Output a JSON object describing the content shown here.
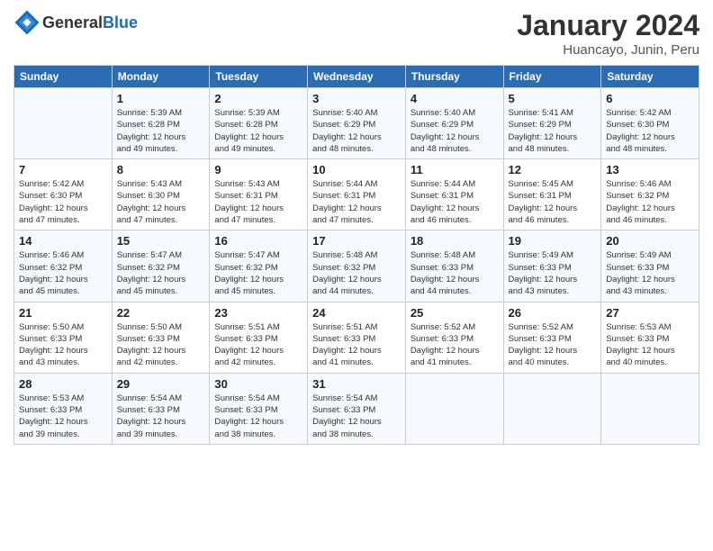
{
  "header": {
    "logo_general": "General",
    "logo_blue": "Blue",
    "month_year": "January 2024",
    "location": "Huancayo, Junin, Peru"
  },
  "days_of_week": [
    "Sunday",
    "Monday",
    "Tuesday",
    "Wednesday",
    "Thursday",
    "Friday",
    "Saturday"
  ],
  "weeks": [
    [
      {
        "day": "",
        "info": ""
      },
      {
        "day": "1",
        "info": "Sunrise: 5:39 AM\nSunset: 6:28 PM\nDaylight: 12 hours\nand 49 minutes."
      },
      {
        "day": "2",
        "info": "Sunrise: 5:39 AM\nSunset: 6:28 PM\nDaylight: 12 hours\nand 49 minutes."
      },
      {
        "day": "3",
        "info": "Sunrise: 5:40 AM\nSunset: 6:29 PM\nDaylight: 12 hours\nand 48 minutes."
      },
      {
        "day": "4",
        "info": "Sunrise: 5:40 AM\nSunset: 6:29 PM\nDaylight: 12 hours\nand 48 minutes."
      },
      {
        "day": "5",
        "info": "Sunrise: 5:41 AM\nSunset: 6:29 PM\nDaylight: 12 hours\nand 48 minutes."
      },
      {
        "day": "6",
        "info": "Sunrise: 5:42 AM\nSunset: 6:30 PM\nDaylight: 12 hours\nand 48 minutes."
      }
    ],
    [
      {
        "day": "7",
        "info": "Sunrise: 5:42 AM\nSunset: 6:30 PM\nDaylight: 12 hours\nand 47 minutes."
      },
      {
        "day": "8",
        "info": "Sunrise: 5:43 AM\nSunset: 6:30 PM\nDaylight: 12 hours\nand 47 minutes."
      },
      {
        "day": "9",
        "info": "Sunrise: 5:43 AM\nSunset: 6:31 PM\nDaylight: 12 hours\nand 47 minutes."
      },
      {
        "day": "10",
        "info": "Sunrise: 5:44 AM\nSunset: 6:31 PM\nDaylight: 12 hours\nand 47 minutes."
      },
      {
        "day": "11",
        "info": "Sunrise: 5:44 AM\nSunset: 6:31 PM\nDaylight: 12 hours\nand 46 minutes."
      },
      {
        "day": "12",
        "info": "Sunrise: 5:45 AM\nSunset: 6:31 PM\nDaylight: 12 hours\nand 46 minutes."
      },
      {
        "day": "13",
        "info": "Sunrise: 5:46 AM\nSunset: 6:32 PM\nDaylight: 12 hours\nand 46 minutes."
      }
    ],
    [
      {
        "day": "14",
        "info": "Sunrise: 5:46 AM\nSunset: 6:32 PM\nDaylight: 12 hours\nand 45 minutes."
      },
      {
        "day": "15",
        "info": "Sunrise: 5:47 AM\nSunset: 6:32 PM\nDaylight: 12 hours\nand 45 minutes."
      },
      {
        "day": "16",
        "info": "Sunrise: 5:47 AM\nSunset: 6:32 PM\nDaylight: 12 hours\nand 45 minutes."
      },
      {
        "day": "17",
        "info": "Sunrise: 5:48 AM\nSunset: 6:32 PM\nDaylight: 12 hours\nand 44 minutes."
      },
      {
        "day": "18",
        "info": "Sunrise: 5:48 AM\nSunset: 6:33 PM\nDaylight: 12 hours\nand 44 minutes."
      },
      {
        "day": "19",
        "info": "Sunrise: 5:49 AM\nSunset: 6:33 PM\nDaylight: 12 hours\nand 43 minutes."
      },
      {
        "day": "20",
        "info": "Sunrise: 5:49 AM\nSunset: 6:33 PM\nDaylight: 12 hours\nand 43 minutes."
      }
    ],
    [
      {
        "day": "21",
        "info": "Sunrise: 5:50 AM\nSunset: 6:33 PM\nDaylight: 12 hours\nand 43 minutes."
      },
      {
        "day": "22",
        "info": "Sunrise: 5:50 AM\nSunset: 6:33 PM\nDaylight: 12 hours\nand 42 minutes."
      },
      {
        "day": "23",
        "info": "Sunrise: 5:51 AM\nSunset: 6:33 PM\nDaylight: 12 hours\nand 42 minutes."
      },
      {
        "day": "24",
        "info": "Sunrise: 5:51 AM\nSunset: 6:33 PM\nDaylight: 12 hours\nand 41 minutes."
      },
      {
        "day": "25",
        "info": "Sunrise: 5:52 AM\nSunset: 6:33 PM\nDaylight: 12 hours\nand 41 minutes."
      },
      {
        "day": "26",
        "info": "Sunrise: 5:52 AM\nSunset: 6:33 PM\nDaylight: 12 hours\nand 40 minutes."
      },
      {
        "day": "27",
        "info": "Sunrise: 5:53 AM\nSunset: 6:33 PM\nDaylight: 12 hours\nand 40 minutes."
      }
    ],
    [
      {
        "day": "28",
        "info": "Sunrise: 5:53 AM\nSunset: 6:33 PM\nDaylight: 12 hours\nand 39 minutes."
      },
      {
        "day": "29",
        "info": "Sunrise: 5:54 AM\nSunset: 6:33 PM\nDaylight: 12 hours\nand 39 minutes."
      },
      {
        "day": "30",
        "info": "Sunrise: 5:54 AM\nSunset: 6:33 PM\nDaylight: 12 hours\nand 38 minutes."
      },
      {
        "day": "31",
        "info": "Sunrise: 5:54 AM\nSunset: 6:33 PM\nDaylight: 12 hours\nand 38 minutes."
      },
      {
        "day": "",
        "info": ""
      },
      {
        "day": "",
        "info": ""
      },
      {
        "day": "",
        "info": ""
      }
    ]
  ]
}
